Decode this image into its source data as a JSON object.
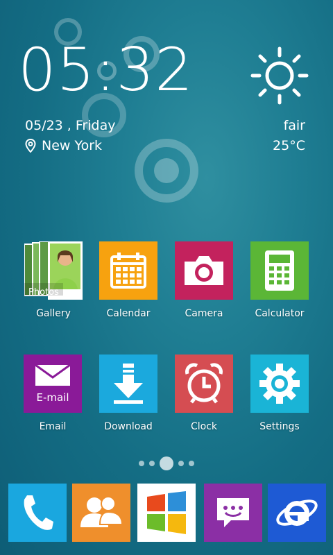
{
  "clock": {
    "time": "05:32",
    "date": "05/23 , Friday",
    "location": "New York"
  },
  "weather": {
    "condition": "fair",
    "temperature": "25°C",
    "icon": "sun-icon"
  },
  "apps_row1": [
    {
      "label": "Gallery",
      "icon": "gallery-icon",
      "color": "#ffffff",
      "overlay": "Photos"
    },
    {
      "label": "Calendar",
      "icon": "calendar-icon",
      "color": "#f7a20f"
    },
    {
      "label": "Camera",
      "icon": "camera-icon",
      "color": "#c3225d"
    },
    {
      "label": "Calculator",
      "icon": "calculator-icon",
      "color": "#5bb636"
    }
  ],
  "apps_row2": [
    {
      "label": "Email",
      "icon": "mail-icon",
      "color": "#8a1a98",
      "tile_text": "E-mail"
    },
    {
      "label": "Download",
      "icon": "download-icon",
      "color": "#1ba9dd"
    },
    {
      "label": "Clock",
      "icon": "alarm-clock-icon",
      "color": "#d54d52"
    },
    {
      "label": "Settings",
      "icon": "gear-icon",
      "color": "#1ab4d6"
    }
  ],
  "pager": {
    "pages": 5,
    "current": 3
  },
  "dock": [
    {
      "icon": "phone-icon",
      "color": "#1aa7df"
    },
    {
      "icon": "contacts-icon",
      "color": "#ef8f2c"
    },
    {
      "icon": "windows-logo-icon",
      "color": "#ffffff"
    },
    {
      "icon": "messaging-icon",
      "color": "#8b2fa5"
    },
    {
      "icon": "internet-explorer-icon",
      "color": "#1e5ad4"
    }
  ]
}
